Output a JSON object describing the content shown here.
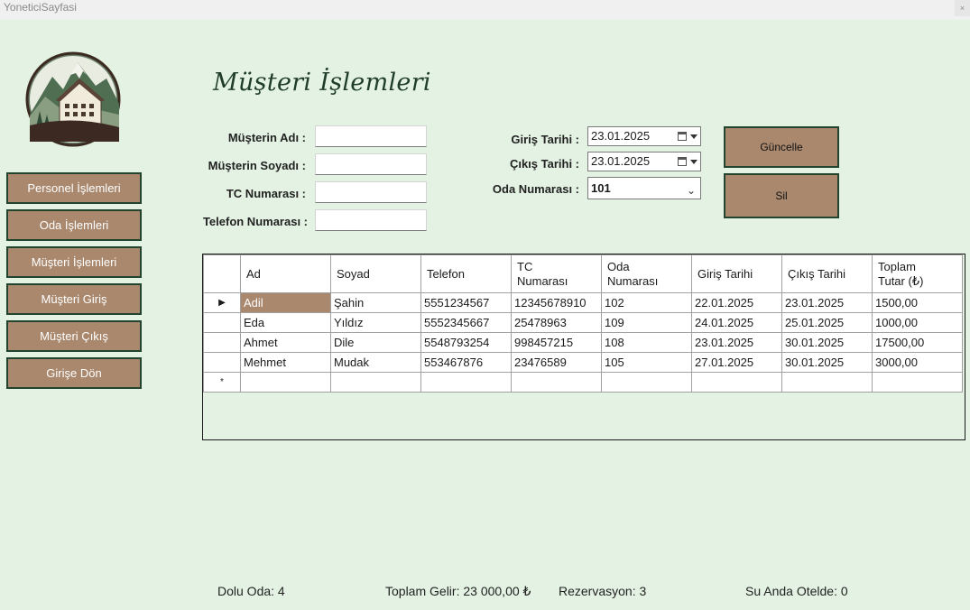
{
  "window": {
    "title": "YoneticiSayfasi",
    "close_glyph": "×"
  },
  "nav": [
    "Personel İşlemleri",
    "Oda İşlemleri",
    "Müşteri İşlemleri",
    "Müşteri Giriş",
    "Müşteri Çıkış",
    "Girişe Dön"
  ],
  "page": {
    "title": "Müşteri İşlemleri"
  },
  "form": {
    "first_name_label": "Müşterin Adı :",
    "last_name_label": "Müşterin Soyadı :",
    "tc_label": "TC Numarası :",
    "phone_label": "Telefon Numarası :",
    "checkin_label": "Giriş Tarihi :",
    "checkin_value": "23.01.2025",
    "checkout_label": "Çıkış Tarihi :",
    "checkout_value": "23.01.2025",
    "room_label": "Oda Numarası :",
    "room_value": "101"
  },
  "actions": {
    "update": "Güncelle",
    "delete": "Sil"
  },
  "grid": {
    "columns": [
      "Ad",
      "Soyad",
      "Telefon",
      "TC\nNumarası",
      "Oda\nNumarası",
      "Giriş Tarihi",
      "Çıkış Tarihi",
      "Toplam\nTutar (₺)"
    ],
    "rows": [
      [
        "Adil",
        "Şahin",
        "5551234567",
        "12345678910",
        "102",
        "22.01.2025",
        "23.01.2025",
        "1500,00"
      ],
      [
        "Eda",
        "Yıldız",
        "5552345667",
        "25478963",
        "109",
        "24.01.2025",
        "25.01.2025",
        "1000,00"
      ],
      [
        "Ahmet",
        "Dile",
        "5548793254",
        "998457215",
        "108",
        "23.01.2025",
        "30.01.2025",
        "17500,00"
      ],
      [
        "Mehmet",
        "Mudak",
        "553467876",
        "23476589",
        "105",
        "27.01.2025",
        "30.01.2025",
        "3000,00"
      ]
    ],
    "current_row_glyph": "▶",
    "new_row_glyph": "*"
  },
  "status": {
    "occupied": "Dolu Oda: 4",
    "revenue": "Toplam Gelir: 23 000,00 ₺",
    "reservations": "Rezervasyon: 3",
    "in_hotel": "Su Anda Otelde: 0"
  },
  "colors": {
    "background": "#e4f2e3",
    "button": "#a9886e",
    "border": "#22442e",
    "title": "#1f3d2a"
  },
  "icons": {
    "logo": "mountain-house-logo",
    "calendar": "calendar-icon",
    "dropdown": "chevron-down-icon",
    "row_indicator": "row-pointer-icon"
  }
}
